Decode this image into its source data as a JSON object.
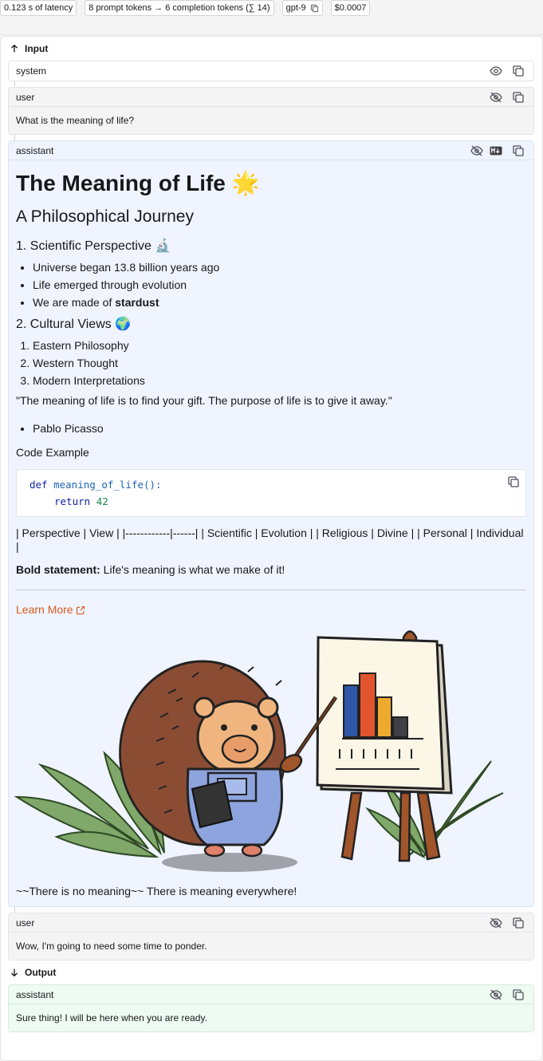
{
  "stats": {
    "latency": "0.123 s of latency",
    "tokens": "8 prompt tokens → 6 completion tokens (∑ 14)",
    "model": "gpt-9",
    "cost": "$0.0007"
  },
  "input_label": "Input",
  "output_label": "Output",
  "messages": {
    "system": {
      "role": "system"
    },
    "user1": {
      "role": "user",
      "text": "What is the meaning of life?"
    },
    "assistant": {
      "role": "assistant",
      "h1": "The Meaning of Life 🌟",
      "h2": "A Philosophical Journey",
      "sci_title": "1. Scientific Perspective 🔬",
      "sci_items": [
        "Universe began 13.8 billion years ago",
        "Life emerged through evolution",
        "We are made of "
      ],
      "sci_bold": "stardust",
      "cult_title": "2. Cultural Views 🌍",
      "cult_items": [
        "Eastern Philosophy",
        "Western Thought",
        "Modern Interpretations"
      ],
      "quote": "\"The meaning of life is to find your gift. The purpose of life is to give it away.\"",
      "author": "Pablo Picasso",
      "code_label": "Code Example",
      "code_line1_kw": "def",
      "code_line1_fn": "meaning_of_life",
      "code_line1_rest": "():",
      "code_line2_kw": "return",
      "code_line2_num": "42",
      "table_text": "| Perspective | View | |------------|------| | Scientific | Evolution | | Religious | Divine | | Personal | Individual |",
      "bold_label": "Bold statement:",
      "bold_text": " Life's meaning is what we make of it!",
      "link": "Learn More",
      "strike": "~~There is no meaning~~ There is meaning everywhere!"
    },
    "user2": {
      "role": "user",
      "text": "Wow, I'm going to need some time to ponder."
    },
    "output": {
      "role": "assistant",
      "text": "Sure thing! I will be here when you are ready."
    }
  },
  "colors": {
    "assistant_bg": "#eff4ff",
    "output_bg": "#eefbf2",
    "link": "#d9581b"
  },
  "icons": [
    "arrow-up-icon",
    "arrow-down-icon",
    "eye-icon",
    "eye-off-icon",
    "copy-icon",
    "markdown-icon",
    "external-link-icon",
    "copy-code-icon"
  ]
}
